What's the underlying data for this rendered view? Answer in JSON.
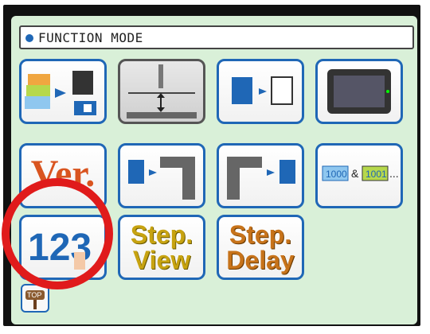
{
  "title": "FUNCTION MODE",
  "buttons": {
    "version": "Ver.",
    "step_view_1": "Step.",
    "step_view_2": "View",
    "step_delay_1": "Step.",
    "step_delay_2": "Delay",
    "pattern_num_1": "1000",
    "pattern_num_2": "1001",
    "amp": "&",
    "ellipsis": "...",
    "digits": "123",
    "top": "TOP"
  },
  "icons": [
    "pattern-to-memory-icon",
    "needle-height-icon",
    "copy-memory-icon",
    "lcd-panel-icon",
    "usb-to-machine-icon",
    "machine-to-usb-icon",
    "numeric-input-icon",
    "top-home-icon"
  ],
  "colors": {
    "screen_bg": "#d9f0d8",
    "button_border": "#1f67b6",
    "highlight_circle": "#e01b1b"
  }
}
